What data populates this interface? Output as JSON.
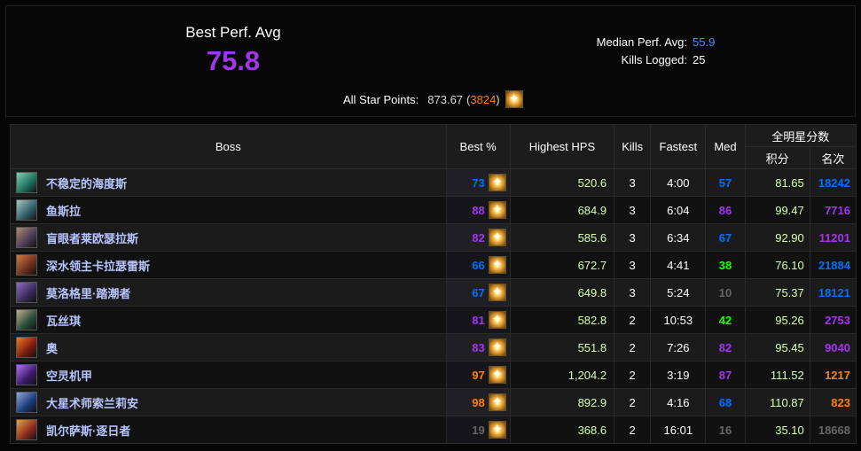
{
  "summary": {
    "best_perf_label": "Best Perf. Avg",
    "best_perf_value": "75.8",
    "median_label": "Median Perf. Avg:",
    "median_value": "55.9",
    "kills_label": "Kills Logged:",
    "kills_value": "25",
    "allstar_label": "All Star Points:",
    "allstar_points": "873.67",
    "allstar_open": "(",
    "allstar_rank": "3824",
    "allstar_close": ")",
    "allstar_icon": "star-burst-icon"
  },
  "table": {
    "headers": {
      "boss": "Boss",
      "best": "Best %",
      "hps": "Highest HPS",
      "kills": "Kills",
      "fastest": "Fastest",
      "med": "Med",
      "allstar_group": "全明星分数",
      "score": "积分",
      "rank": "名次"
    },
    "rows": [
      {
        "boss": "不稳定的海度斯",
        "best": "73",
        "best_color": "rare",
        "hps": "520.6",
        "kills": "3",
        "fastest": "4:00",
        "med": "57",
        "med_color": "rare",
        "score": "81.65",
        "rank": "18242",
        "rank_color": "rare",
        "icon_colors": [
          "#1f6f5a",
          "#7fd0b0"
        ]
      },
      {
        "boss": "鱼斯拉",
        "best": "88",
        "best_color": "epic",
        "hps": "684.9",
        "kills": "3",
        "fastest": "6:04",
        "med": "86",
        "med_color": "epic",
        "score": "99.47",
        "rank": "7716",
        "rank_color": "epic",
        "icon_colors": [
          "#2f5f6a",
          "#a8c8c0"
        ]
      },
      {
        "boss": "盲眼者莱欧瑟拉斯",
        "best": "82",
        "best_color": "epic",
        "hps": "585.6",
        "kills": "3",
        "fastest": "6:34",
        "med": "67",
        "med_color": "rare",
        "score": "92.90",
        "rank": "11201",
        "rank_color": "epic",
        "icon_colors": [
          "#4a3a55",
          "#b08a70"
        ]
      },
      {
        "boss": "深水领主卡拉瑟雷斯",
        "best": "66",
        "best_color": "rare",
        "hps": "672.7",
        "kills": "3",
        "fastest": "4:41",
        "med": "38",
        "med_color": "uncommon",
        "score": "76.10",
        "rank": "21884",
        "rank_color": "rare",
        "icon_colors": [
          "#6a3020",
          "#d07a40"
        ]
      },
      {
        "boss": "莫洛格里·踏潮者",
        "best": "67",
        "best_color": "rare",
        "hps": "649.8",
        "kills": "3",
        "fastest": "5:24",
        "med": "10",
        "med_color": "common",
        "score": "75.37",
        "rank": "18121",
        "rank_color": "rare",
        "icon_colors": [
          "#3a2a5a",
          "#8a70c0"
        ]
      },
      {
        "boss": "瓦丝琪",
        "best": "81",
        "best_color": "epic",
        "hps": "582.8",
        "kills": "2",
        "fastest": "10:53",
        "med": "42",
        "med_color": "uncommon",
        "score": "95.26",
        "rank": "2753",
        "rank_color": "epic",
        "icon_colors": [
          "#2a4a3a",
          "#c0b090"
        ]
      },
      {
        "boss": "奥",
        "best": "83",
        "best_color": "epic",
        "hps": "551.8",
        "kills": "2",
        "fastest": "7:26",
        "med": "82",
        "med_color": "epic",
        "score": "95.45",
        "rank": "9040",
        "rank_color": "epic",
        "icon_colors": [
          "#7a1a10",
          "#f07a20"
        ]
      },
      {
        "boss": "空灵机甲",
        "best": "97",
        "best_color": "legendary",
        "hps": "1,204.2",
        "kills": "2",
        "fastest": "3:19",
        "med": "87",
        "med_color": "epic",
        "score": "111.52",
        "rank": "1217",
        "rank_color": "legendary",
        "icon_colors": [
          "#3a1a6a",
          "#b070f0"
        ]
      },
      {
        "boss": "大星术师索兰莉安",
        "best": "98",
        "best_color": "legendary",
        "hps": "892.9",
        "kills": "2",
        "fastest": "4:16",
        "med": "68",
        "med_color": "rare",
        "score": "110.87",
        "rank": "823",
        "rank_color": "legendary",
        "icon_colors": [
          "#1a3a7a",
          "#90a8e0"
        ]
      },
      {
        "boss": "凯尔萨斯·逐日者",
        "best": "19",
        "best_color": "common",
        "hps": "368.6",
        "kills": "2",
        "fastest": "16:01",
        "med": "16",
        "med_color": "common",
        "score": "35.10",
        "rank": "18668",
        "rank_color": "common",
        "icon_colors": [
          "#8a2a20",
          "#f0a040"
        ]
      }
    ]
  }
}
